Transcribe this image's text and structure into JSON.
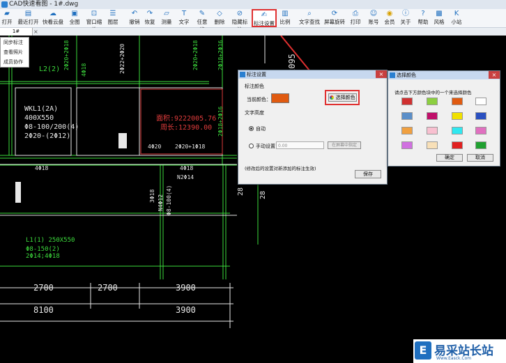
{
  "window": {
    "title": "CAD快速看图 - 1#.dwg"
  },
  "toolbar": [
    {
      "label": "打开",
      "icon": "folder-icon"
    },
    {
      "label": "最近打开",
      "icon": "recent-icon"
    },
    {
      "label": "快看云盘",
      "icon": "cloud-icon"
    },
    {
      "label": "全图",
      "icon": "fullview-icon"
    },
    {
      "label": "窗口缩放",
      "icon": "window-zoom-icon"
    },
    {
      "label": "图层",
      "icon": "layers-icon"
    },
    {
      "label": "撤销",
      "icon": "undo-icon"
    },
    {
      "label": "恢复",
      "icon": "redo-icon"
    },
    {
      "label": "测量",
      "icon": "measure-icon"
    },
    {
      "label": "文字",
      "icon": "text-icon"
    },
    {
      "label": "任意线",
      "icon": "pen-icon"
    },
    {
      "label": "删除",
      "icon": "eraser-icon"
    },
    {
      "label": "隐藏标注",
      "icon": "hide-icon"
    },
    {
      "label": "标注设置",
      "icon": "annotation-settings-icon"
    },
    {
      "label": "比例",
      "icon": "scale-icon"
    },
    {
      "label": "文字查找",
      "icon": "text-search-icon"
    },
    {
      "label": "屏幕旋转",
      "icon": "rotate-icon"
    },
    {
      "label": "打印",
      "icon": "print-icon"
    },
    {
      "label": "账号",
      "icon": "account-icon"
    },
    {
      "label": "会员",
      "icon": "vip-icon"
    },
    {
      "label": "关于",
      "icon": "about-icon"
    },
    {
      "label": "帮助",
      "icon": "help-icon"
    },
    {
      "label": "风格",
      "icon": "style-icon"
    },
    {
      "label": "小站",
      "icon": "k-icon"
    }
  ],
  "tab": {
    "name": "1#",
    "close": "×"
  },
  "side_menu": [
    "同步标注",
    "查看照片",
    "成员协作"
  ],
  "cad_text": {
    "t2095": "2095",
    "t2o18a": "2Φ20+2Φ18",
    "t2o22": "2Φ22+2Φ20",
    "t2o20b": "2Φ20+2Φ18",
    "t2o18c": "2Φ18+2Φ16",
    "l2": "L2(2)",
    "o18v": "4Φ18",
    "wkl": "WKL1(2A)",
    "wkl2": "400X550",
    "wkl3": "Φ8-100/200(4)",
    "wkl4": "2Φ20-(2Φ12)",
    "red1": "面积:9222005.76",
    "red2": "周长:12390.00",
    "o22v": "4Φ22",
    "o20": "4Φ20",
    "o20b": "2Φ20+1Φ18",
    "o18a": "4Φ18",
    "o18b": "4Φ18",
    "n2": "N2Φ14",
    "o12": "3Φ18",
    "n4": "N4Φ12",
    "o8": "Φ8-100(4)",
    "l1a": "L1(1) 250X550",
    "l1b": "Φ8-150(2)",
    "l1c": "2Φ14;4Φ18",
    "n2700a": "2700",
    "n2700b": "2700",
    "n3900a": "3900",
    "n8100": "8100",
    "n3900b": "3900",
    "n28a": "28",
    "n28b": "28",
    "o18d": "2Φ18+2Φ16"
  },
  "dialog_annotation": {
    "title": "标注设置",
    "section_color": "标注颜色",
    "current_color_label": "当前颜色：",
    "current_color": "#e05a10",
    "select_color_btn": "选择颜色",
    "section_height": "文字高度",
    "auto_label": "自动",
    "manual_label": "手动设置",
    "manual_value": "0.00",
    "pick_btn": "在屏幕中指定",
    "note": "(修改后的设置对新添加的标注生效)",
    "save_btn": "保存"
  },
  "dialog_palette": {
    "title": "选择颜色",
    "instruction": "请点击下方颜色块中的一个来选择颜色",
    "colors": [
      "#d03030",
      "#8ccf40",
      "#e05a10",
      "#ffffff",
      "#5a8ec8",
      "#c0106a",
      "#f0e000",
      "#2a50c0",
      "#f0a040",
      "#f8c0d0",
      "#30e8f0",
      "#e070c0",
      "#d070e0",
      "#f8e0b8",
      "#e02020",
      "#20a030"
    ],
    "ok_btn": "确定",
    "cancel_btn": "取消"
  },
  "watermark": {
    "brand": "易采站长站",
    "url": "Www.Easck.Com"
  },
  "colors": {
    "cad_green": "#3ddc3d",
    "cad_white": "#e8e8e8",
    "cad_red": "#e03c3c",
    "highlight": "#e03030"
  }
}
